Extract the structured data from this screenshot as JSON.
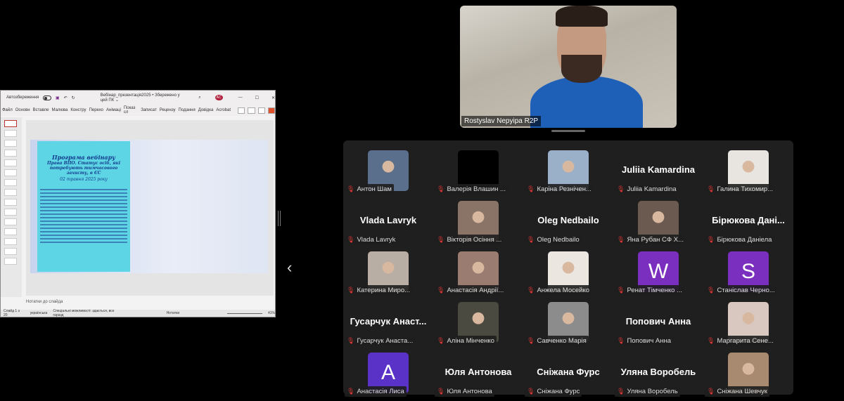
{
  "ppt": {
    "autosave": "Автозбереження",
    "doc_title": "Вебінар_презентація2025 • Збережено у цей ПК ⌄",
    "avatar": "AC",
    "tabs": [
      "Файл",
      "Основн",
      "Вставле",
      "Малюва",
      "Констру",
      "Перехо",
      "Анімаці",
      "Показ сл",
      "Записат",
      "Рецензу",
      "Подання",
      "Довідка",
      "Acrobat"
    ],
    "slide": {
      "title": "Програма вебінару",
      "subtitle": "Права ВПО. Статус осіб, які потребують тимчасового захисту, в ЄС",
      "date": "02 травня 2025 року"
    },
    "notes": "Нотатки до слайда",
    "status_slide": "Слайд 1 з 20",
    "status_lang": "українська",
    "status_access": "Спеціальні можливості: здається, все гаразд",
    "status_notes": "Нотатки",
    "zoom": "41%"
  },
  "speaker": {
    "name": "Rostyslav Nepyipa R2P"
  },
  "participants": [
    {
      "label": "Антон Шам",
      "type": "photo",
      "color": "#5a6f8c"
    },
    {
      "label": "Валерія Влашин ...",
      "type": "photo",
      "color": "#000000"
    },
    {
      "label": "Каріна Резнічен...",
      "type": "photo",
      "color": "#9ab0c8"
    },
    {
      "label": "Juliia Kamardina",
      "type": "name",
      "display": "Juliia Kamardina"
    },
    {
      "label": "Галина Тихомир...",
      "type": "photo",
      "color": "#e8e4e0"
    },
    {
      "label": "Vlada Lavryk",
      "type": "name",
      "display": "Vlada Lavryk"
    },
    {
      "label": "Вікторія Осіння ...",
      "type": "photo",
      "color": "#8a7468"
    },
    {
      "label": "Oleg Nedbailo",
      "type": "name",
      "display": "Oleg Nedbailo"
    },
    {
      "label": "Яна Рубан СФ Х...",
      "type": "photo",
      "color": "#6a5a50"
    },
    {
      "label": "Бірюкова Даніела",
      "type": "name",
      "display": "Бірюкова Дані..."
    },
    {
      "label": "Катерина Миро...",
      "type": "photo",
      "color": "#b8aea4"
    },
    {
      "label": "Анастасія Андрії...",
      "type": "photo",
      "color": "#9a7c70"
    },
    {
      "label": "Анжела Мосейко",
      "type": "photo",
      "color": "#ece6e0"
    },
    {
      "label": "Ренат Тімченко ...",
      "type": "letter",
      "display": "W",
      "color": "#7b2fbe"
    },
    {
      "label": "Станіслав Черно...",
      "type": "letter",
      "display": "S",
      "color": "#7b2fbe"
    },
    {
      "label": "Гусарчук Анаста...",
      "type": "name",
      "display": "Гусарчук  Анаст..."
    },
    {
      "label": "Аліна Мінченко",
      "type": "photo",
      "color": "#4a4a40"
    },
    {
      "label": "Савченко Марія",
      "type": "photo",
      "color": "#8c8c8c"
    },
    {
      "label": "Попович Анна",
      "type": "name",
      "display": "Попович Анна"
    },
    {
      "label": "Маргарита Сене...",
      "type": "photo",
      "color": "#d8c8c0"
    },
    {
      "label": "Анастасія Лиса",
      "type": "letter",
      "display": "A",
      "color": "#5a32c8"
    },
    {
      "label": "Юля Антонова",
      "type": "name",
      "display": "Юля Антонова"
    },
    {
      "label": "Сніжана Фурс",
      "type": "name",
      "display": "Сніжана Фурс"
    },
    {
      "label": "Уляна Воробель",
      "type": "name",
      "display": "Уляна Воробель"
    },
    {
      "label": "Сніжана Шевчук",
      "type": "photo",
      "color": "#a88a70"
    }
  ]
}
